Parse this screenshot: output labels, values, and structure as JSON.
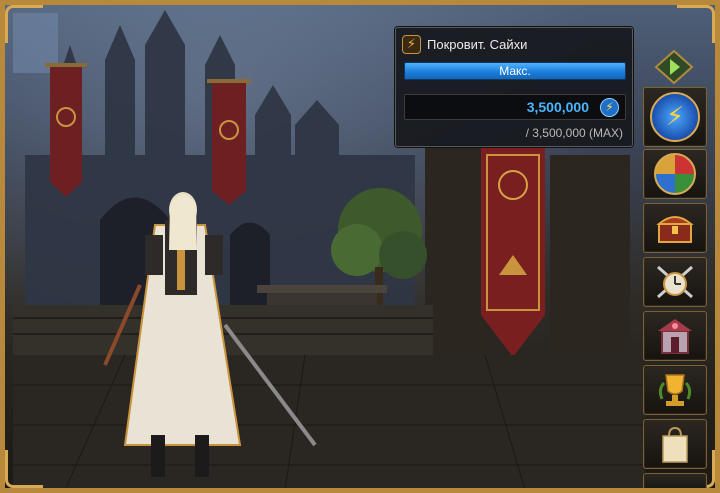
{
  "panel": {
    "badge_icon": "lightning-icon",
    "title": "Покровит. Сайхи",
    "bar_label": "Макс.",
    "bar_fill": 1.0,
    "value": "3,500,000",
    "value_icon": "lightning-coin-icon",
    "max_text": "/ 3,500,000 (MAX)"
  },
  "menu": {
    "items": [
      {
        "name": "arrow-nav-icon"
      },
      {
        "name": "lightning-icon"
      },
      {
        "name": "elements-icon"
      },
      {
        "name": "treasure-chest-icon"
      },
      {
        "name": "crossed-swords-clock-icon"
      },
      {
        "name": "shrine-icon"
      },
      {
        "name": "trophy-icon"
      },
      {
        "name": "shopping-bag-icon"
      }
    ]
  },
  "colors": {
    "frame_gold": "#b8893a",
    "bar_blue": "#1c7fdc",
    "value_blue": "#4ab6ff"
  }
}
